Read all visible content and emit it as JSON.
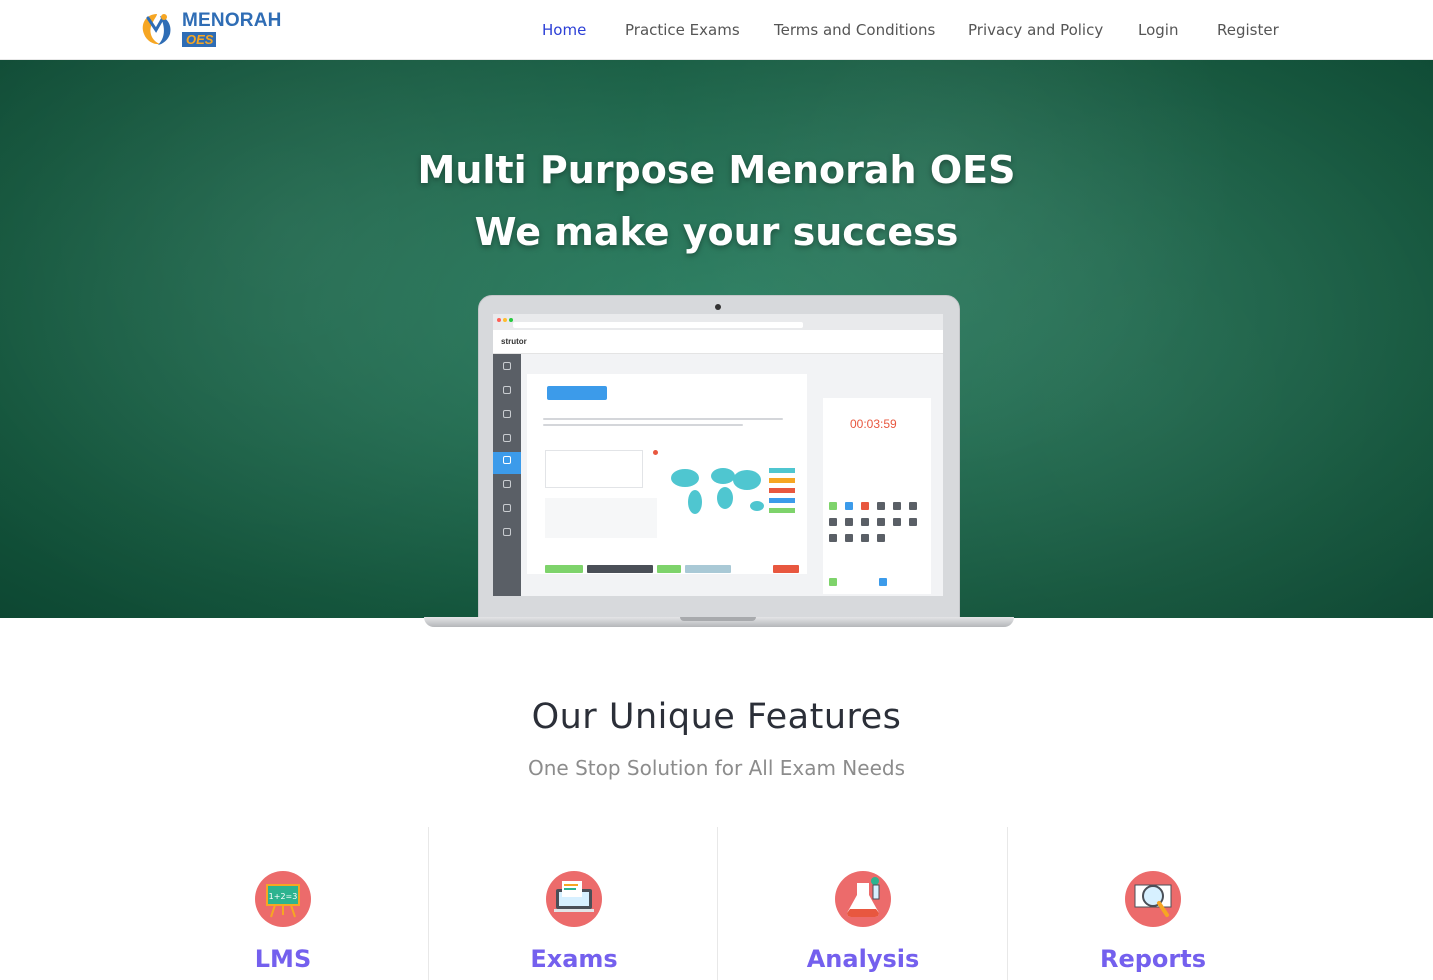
{
  "brand": {
    "name": "MENORAH",
    "sub": "OES"
  },
  "nav": {
    "items": [
      {
        "label": "Home",
        "active": true
      },
      {
        "label": "Practice Exams",
        "active": false
      },
      {
        "label": "Terms and Conditions",
        "active": false
      },
      {
        "label": "Privacy and Policy",
        "active": false
      },
      {
        "label": "Login",
        "active": false
      },
      {
        "label": "Register",
        "active": false
      }
    ]
  },
  "hero": {
    "title_line1": "Multi Purpose Menorah OES",
    "title_line2": "We make your success",
    "mockup": {
      "brand": "strutor",
      "timer": "00:03:59"
    }
  },
  "features": {
    "title": "Our Unique Features",
    "subtitle": "One Stop Solution for All Exam Needs",
    "items": [
      {
        "label": "LMS",
        "icon": "chalkboard-icon"
      },
      {
        "label": "Exams",
        "icon": "exam-papers-icon"
      },
      {
        "label": "Analysis",
        "icon": "flask-icon"
      },
      {
        "label": "Reports",
        "icon": "magnifier-report-icon"
      }
    ]
  },
  "colors": {
    "nav_active": "#2b3fd6",
    "hero_green": "#226b50",
    "feature_label": "#7460ee",
    "feature_icon_bg": "#ec6b6b"
  }
}
